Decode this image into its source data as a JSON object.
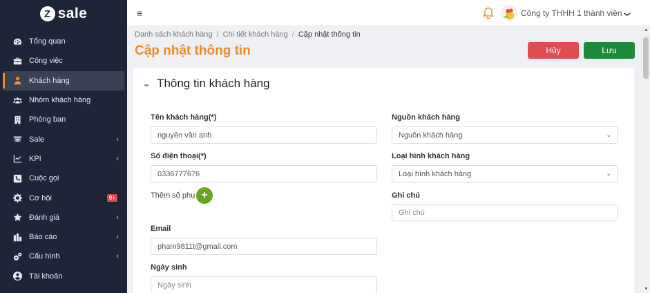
{
  "brand": {
    "mark": "Z",
    "name": "sale"
  },
  "sidebar": {
    "items": [
      {
        "label": "Tổng quan",
        "icon": "dashboard-icon"
      },
      {
        "label": "Công việc",
        "icon": "briefcase-icon"
      },
      {
        "label": "Khách hàng",
        "icon": "user-icon",
        "active": true
      },
      {
        "label": "Nhóm khách hàng",
        "icon": "users-icon"
      },
      {
        "label": "Phòng ban",
        "icon": "building-icon"
      },
      {
        "label": "Sale",
        "icon": "dollar-icon",
        "has_submenu": true
      },
      {
        "label": "KPI",
        "icon": "chart-icon",
        "has_submenu": true
      },
      {
        "label": "Cuộc gọi",
        "icon": "phone-icon"
      },
      {
        "label": "Cơ hội",
        "icon": "gear-icon",
        "badge": "9+"
      },
      {
        "label": "Đánh giá",
        "icon": "star-icon",
        "has_submenu": true
      },
      {
        "label": "Báo cáo",
        "icon": "report-icon",
        "has_submenu": true
      },
      {
        "label": "Cấu hình",
        "icon": "cogs-icon",
        "has_submenu": true
      },
      {
        "label": "Tài khoản",
        "icon": "account-icon"
      }
    ]
  },
  "topbar": {
    "menu_icon": "≡",
    "company": "Công ty THHH 1 thành viên",
    "chevron": "❯"
  },
  "breadcrumb": {
    "items": [
      "Danh sách khách hàng",
      "Chi tiết khách hàng",
      "Cập nhật thông tin"
    ],
    "separator": "/"
  },
  "page": {
    "title": "Cập nhật thông tin",
    "cancel_label": "Hủy",
    "save_label": "Lưu"
  },
  "card": {
    "title": "Thông tin khách hàng"
  },
  "form": {
    "name": {
      "label": "Tên khách hàng(*)",
      "value": "nguyễn văn anh"
    },
    "phone": {
      "label": "Số điện thoại(*)",
      "value": "0336777676"
    },
    "extra_phone": {
      "label": "Thêm số phụ",
      "button": "+"
    },
    "email": {
      "label": "Email",
      "value": "pham9811t@gmail.com"
    },
    "birthday": {
      "label": "Ngày sinh",
      "placeholder": "Ngày sinh"
    },
    "source": {
      "label": "Nguồn khách hàng",
      "selected": "Nguồn khách hàng"
    },
    "type": {
      "label": "Loại hình khách hàng",
      "selected": "Loại hình khách hàng"
    },
    "note": {
      "label": "Ghi chú",
      "placeholder": "Ghi chú"
    }
  },
  "colors": {
    "sidebar_bg": "#1e2538",
    "accent": "#f08a24",
    "cancel": "#e04c52",
    "save": "#1d8a3a",
    "add": "#6aa51e"
  }
}
